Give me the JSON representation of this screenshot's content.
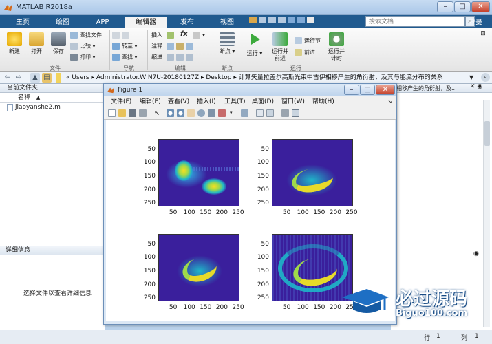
{
  "window": {
    "title": "MATLAB R2018a",
    "min": "–",
    "max": "□",
    "close": "✕"
  },
  "tabs": [
    {
      "label": "主页",
      "active": false
    },
    {
      "label": "绘图",
      "active": false
    },
    {
      "label": "APP",
      "active": false
    },
    {
      "label": "编辑器",
      "active": true
    },
    {
      "label": "发布",
      "active": false
    },
    {
      "label": "视图",
      "active": false
    }
  ],
  "search": {
    "placeholder": "搜索文档",
    "login": "登录"
  },
  "ribbon": {
    "file": {
      "new": "新建",
      "open": "打开",
      "save": "保存",
      "find_files": "查找文件",
      "compare": "比较",
      "print": "打印",
      "group": "文件"
    },
    "nav": {
      "goto": "转至",
      "find": "查找",
      "group": "导航"
    },
    "edit": {
      "insert": "插入",
      "comment": "注释",
      "indent": "缩进",
      "fx": "fx",
      "group": "编辑"
    },
    "breakpoints": {
      "label": "断点",
      "group": "断点"
    },
    "run": {
      "run": "运行",
      "run_advance_1": "运行并",
      "run_advance_2": "前进",
      "run_section": "运行节",
      "advance": "前进",
      "run_time_1": "运行并",
      "run_time_2": "计时",
      "group": "运行"
    }
  },
  "address": {
    "segments": [
      "«",
      "Users",
      "▸",
      "Administrator.WIN7U-20180127Z",
      "▸",
      "Desktop",
      "▸",
      "计算矢量拉盖尔高斯光束中古伊相移产生的角衍射，及其与能流分布的关系"
    ]
  },
  "left_panel": {
    "title": "当前文件夹",
    "col_name": "名称",
    "col_sort": "▲",
    "file": "jiaoyanshe2.m",
    "details_title": "详细信息",
    "details_text": "选择文件以查看详细信息"
  },
  "right_panel": {
    "text": "相移产生的角衍射，及..."
  },
  "status": {
    "row_label": "行",
    "row": "1",
    "col_label": "列",
    "col": "1"
  },
  "figure": {
    "title": "Figure 1",
    "menu": [
      "文件(F)",
      "编辑(E)",
      "查看(V)",
      "插入(I)",
      "工具(T)",
      "桌面(D)",
      "窗口(W)",
      "帮助(H)"
    ],
    "y_ticks": [
      "50",
      "100",
      "150",
      "200",
      "250"
    ],
    "x_ticks": [
      "50",
      "100",
      "150",
      "200",
      "250"
    ]
  },
  "watermark": {
    "text": "必过源码",
    "url": "Biguo100.com"
  },
  "colors": {
    "tabbar": "#205a8f",
    "titlebar": "#bdd3ec",
    "plot_bg": "#3a1f9c"
  }
}
